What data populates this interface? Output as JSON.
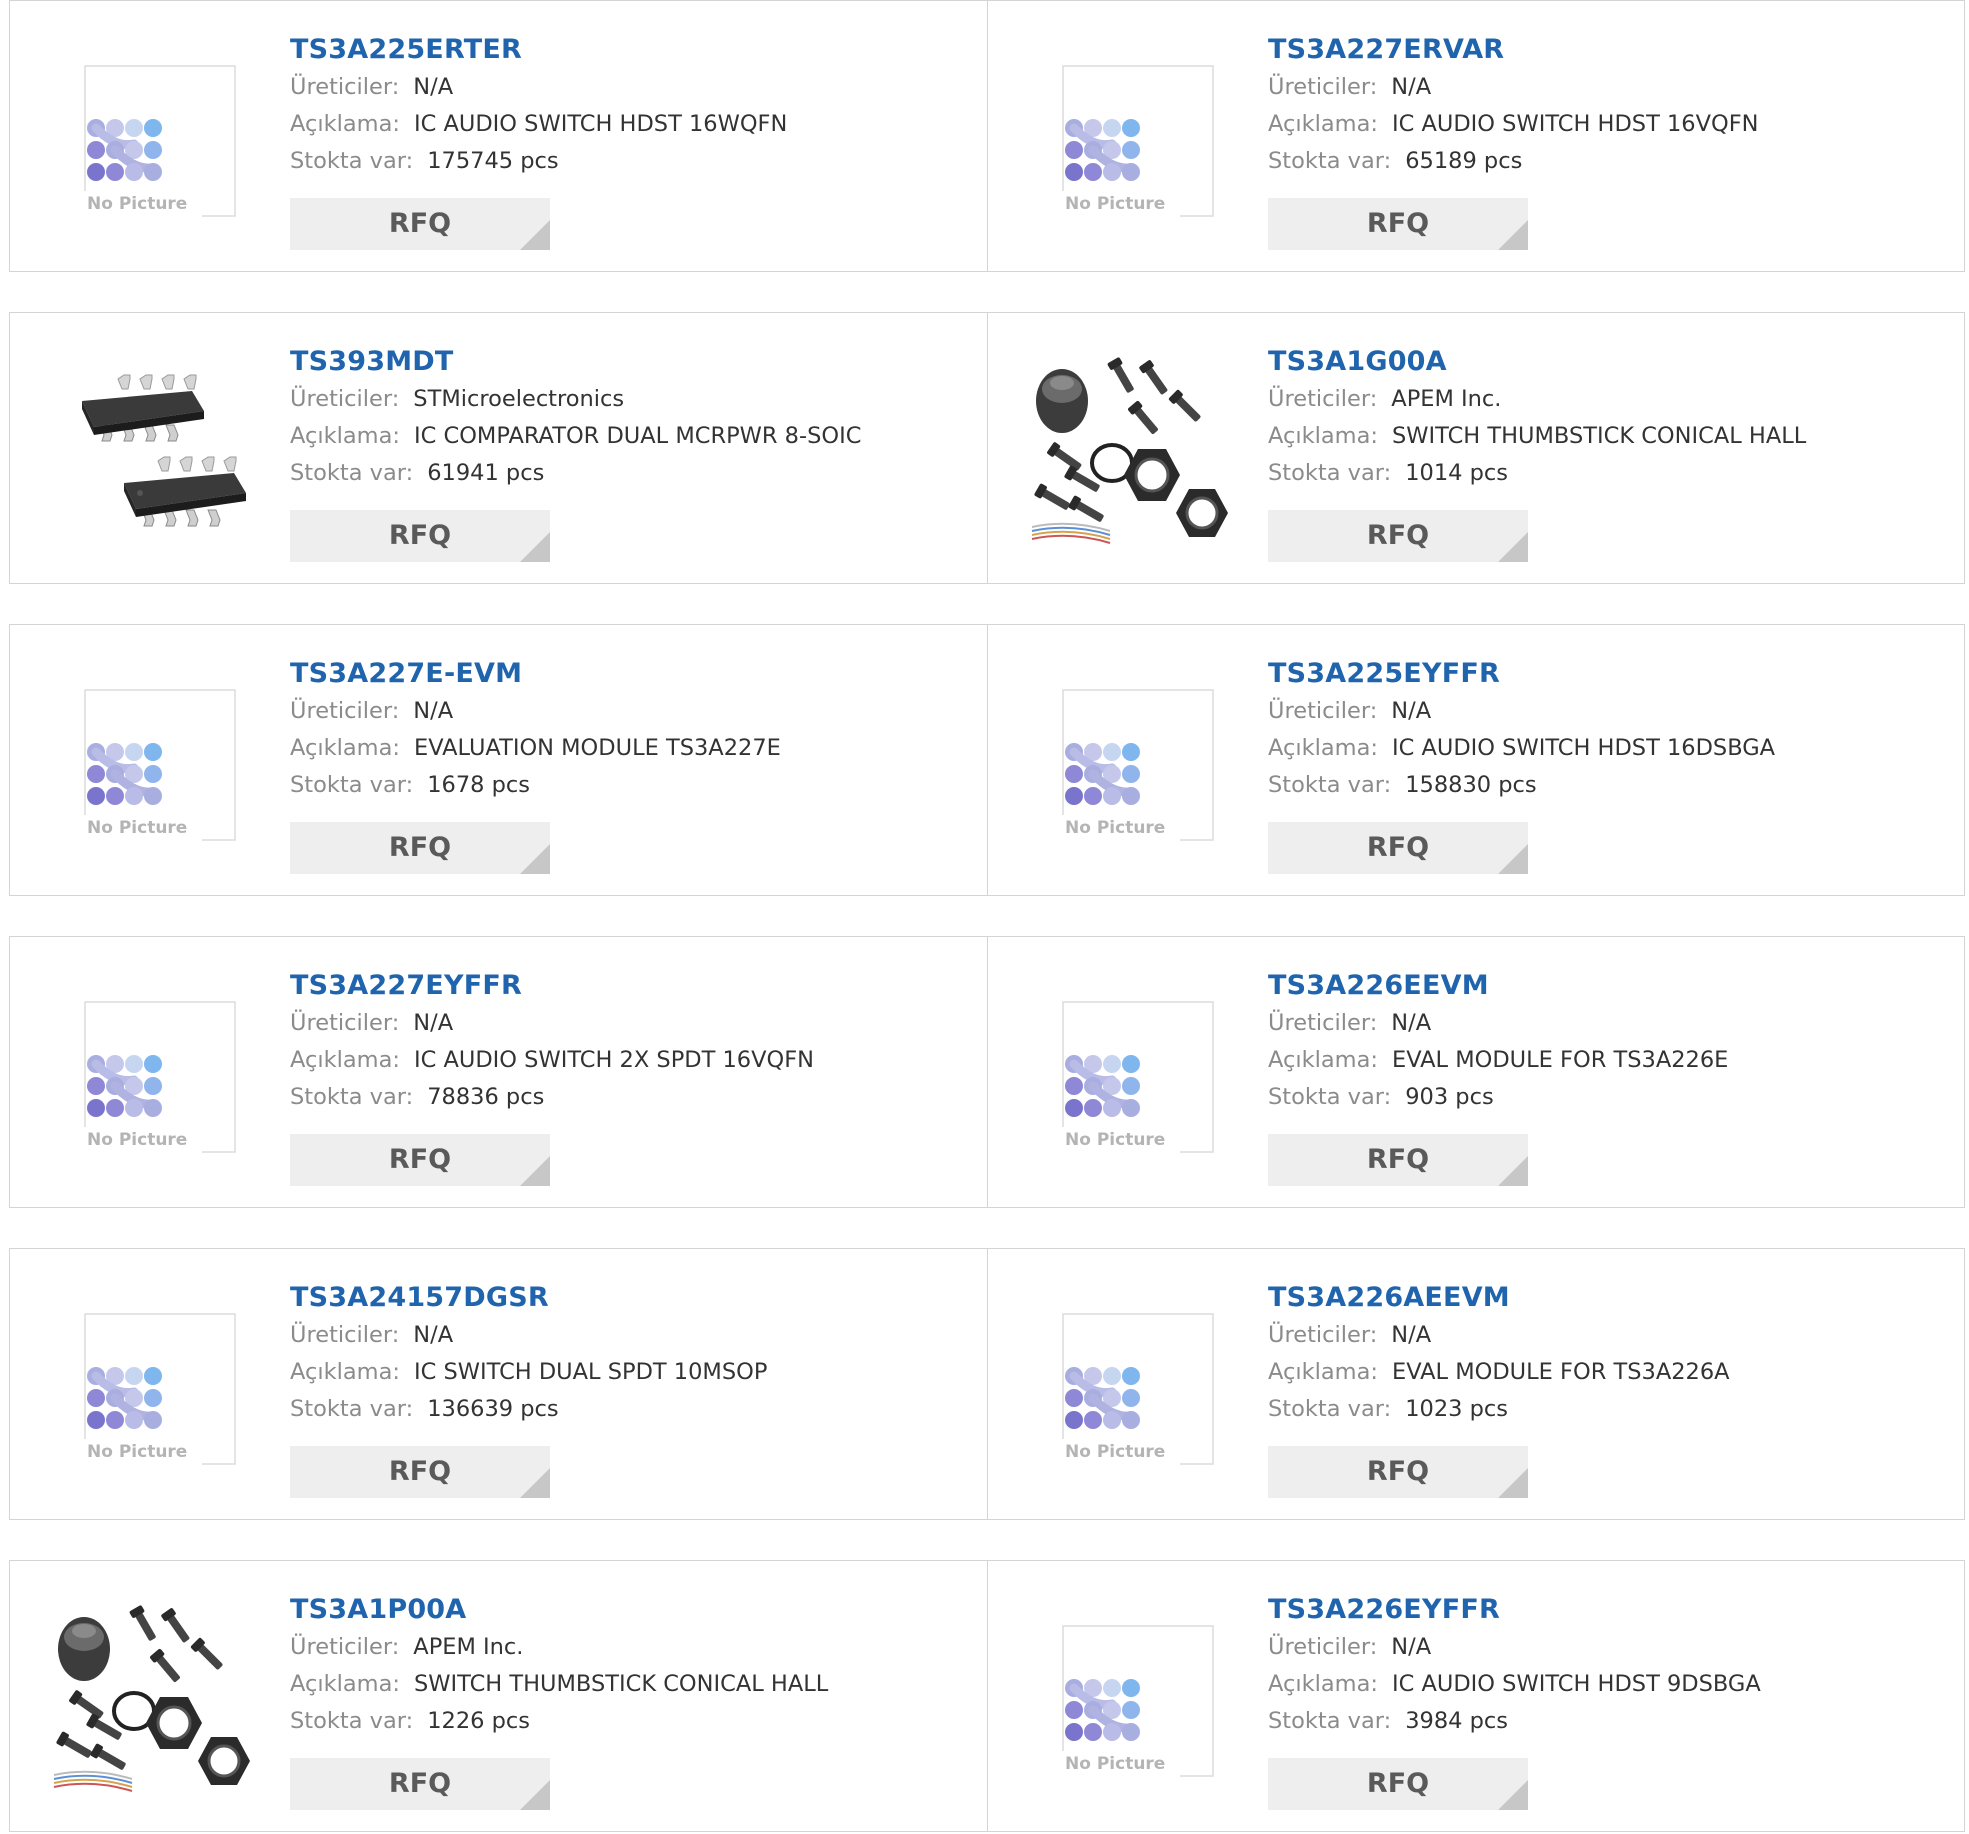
{
  "labels": {
    "manufacturer": "Üreticiler:",
    "description": "Açıklama:",
    "stock": "Stokta var:",
    "rfq": "RFQ",
    "no_picture": "No Picture"
  },
  "products": [
    {
      "part": "TS3A225ERTER",
      "manufacturer": "N/A",
      "description": "IC AUDIO SWITCH HDST 16WQFN",
      "stock": "175745 pcs",
      "image": "no-picture"
    },
    {
      "part": "TS3A227ERVAR",
      "manufacturer": "N/A",
      "description": "IC AUDIO SWITCH HDST 16VQFN",
      "stock": "65189 pcs",
      "image": "no-picture"
    },
    {
      "part": "TS393MDT",
      "manufacturer": "STMicroelectronics",
      "description": "IC COMPARATOR DUAL MCRPWR 8-SOIC",
      "stock": "61941 pcs",
      "image": "soic-chip"
    },
    {
      "part": "TS3A1G00A",
      "manufacturer": "APEM Inc.",
      "description": "SWITCH THUMBSTICK CONICAL HALL",
      "stock": "1014 pcs",
      "image": "thumbstick"
    },
    {
      "part": "TS3A227E-EVM",
      "manufacturer": "N/A",
      "description": "EVALUATION MODULE TS3A227E",
      "stock": "1678 pcs",
      "image": "no-picture"
    },
    {
      "part": "TS3A225EYFFR",
      "manufacturer": "N/A",
      "description": "IC AUDIO SWITCH HDST 16DSBGA",
      "stock": "158830 pcs",
      "image": "no-picture"
    },
    {
      "part": "TS3A227EYFFR",
      "manufacturer": "N/A",
      "description": "IC AUDIO SWITCH 2X SPDT 16VQFN",
      "stock": "78836 pcs",
      "image": "no-picture"
    },
    {
      "part": "TS3A226EEVM",
      "manufacturer": "N/A",
      "description": "EVAL MODULE FOR TS3A226E",
      "stock": "903 pcs",
      "image": "no-picture"
    },
    {
      "part": "TS3A24157DGSR",
      "manufacturer": "N/A",
      "description": "IC SWITCH DUAL SPDT 10MSOP",
      "stock": "136639 pcs",
      "image": "no-picture"
    },
    {
      "part": "TS3A226AEEVM",
      "manufacturer": "N/A",
      "description": "EVAL MODULE FOR TS3A226A",
      "stock": "1023 pcs",
      "image": "no-picture"
    },
    {
      "part": "TS3A1P00A",
      "manufacturer": "APEM Inc.",
      "description": "SWITCH THUMBSTICK CONICAL HALL",
      "stock": "1226 pcs",
      "image": "thumbstick"
    },
    {
      "part": "TS3A226EYFFR",
      "manufacturer": "N/A",
      "description": "IC AUDIO SWITCH HDST 9DSBGA",
      "stock": "3984 pcs",
      "image": "no-picture"
    }
  ],
  "colors": {
    "title": "#1f64ad",
    "label": "#8b8b8b",
    "value": "#333333",
    "border": "#d4d4d4",
    "rfq_bg": "#eeeeee",
    "rfq_text": "#5a5a5a"
  }
}
